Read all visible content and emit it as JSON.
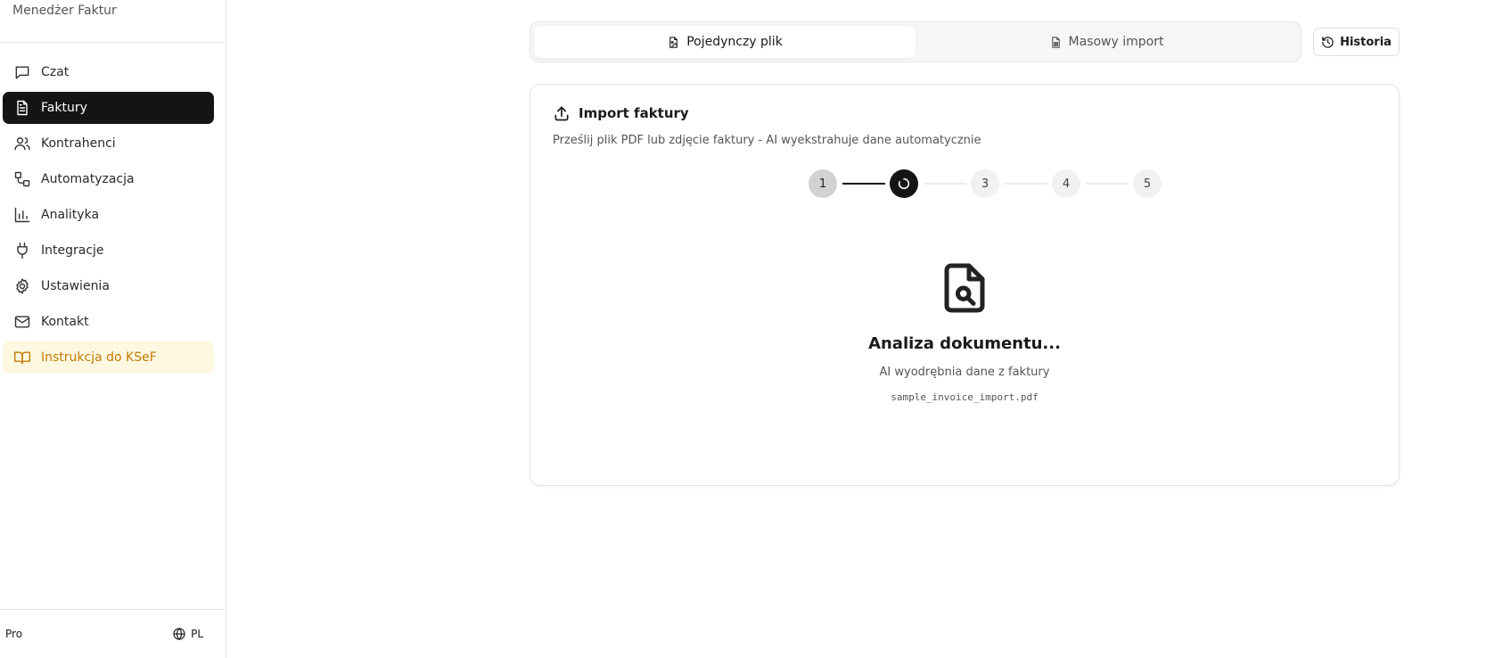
{
  "app": {
    "title": "Menedżer Faktur"
  },
  "sidebar": {
    "items": [
      {
        "label": "Czat",
        "icon": "chat-icon"
      },
      {
        "label": "Faktury",
        "icon": "file-text-icon",
        "active": true
      },
      {
        "label": "Kontrahenci",
        "icon": "users-icon"
      },
      {
        "label": "Automatyzacja",
        "icon": "workflow-icon"
      },
      {
        "label": "Analityka",
        "icon": "bar-chart-icon"
      },
      {
        "label": "Integracje",
        "icon": "plug-icon"
      },
      {
        "label": "Ustawienia",
        "icon": "gear-icon"
      },
      {
        "label": "Kontakt",
        "icon": "mail-icon"
      },
      {
        "label": "Instrukcja do KSeF",
        "icon": "book-open-icon",
        "highlight": true,
        "color": "#c27a06"
      }
    ],
    "footer": {
      "plan": "Pro",
      "language": "PL"
    }
  },
  "tabs": [
    {
      "label": "Pojedynczy plik",
      "icon": "file-image-icon",
      "active": true
    },
    {
      "label": "Masowy import",
      "icon": "file-spreadsheet-icon"
    }
  ],
  "history": {
    "label": "Historia",
    "icon": "history-icon"
  },
  "card": {
    "title": "Import faktury",
    "subtitle": "Prześlij plik PDF lub zdjęcie faktury - AI wyekstrahuje dane automatycznie",
    "steps": [
      {
        "label": "1",
        "state": "done"
      },
      {
        "label": "",
        "state": "current",
        "icon": "spinner-icon"
      },
      {
        "label": "3",
        "state": "pending"
      },
      {
        "label": "4",
        "state": "pending"
      },
      {
        "label": "5",
        "state": "pending"
      }
    ],
    "analysis": {
      "icon": "file-search-icon",
      "title": "Analiza dokumentu...",
      "description": "AI wyodrębnia dane z faktury",
      "filename": "sample_invoice_import.pdf"
    }
  },
  "colors": {
    "active_bg": "#141414",
    "highlight_bg": "#fff8e1",
    "highlight_text": "#c27a06"
  }
}
